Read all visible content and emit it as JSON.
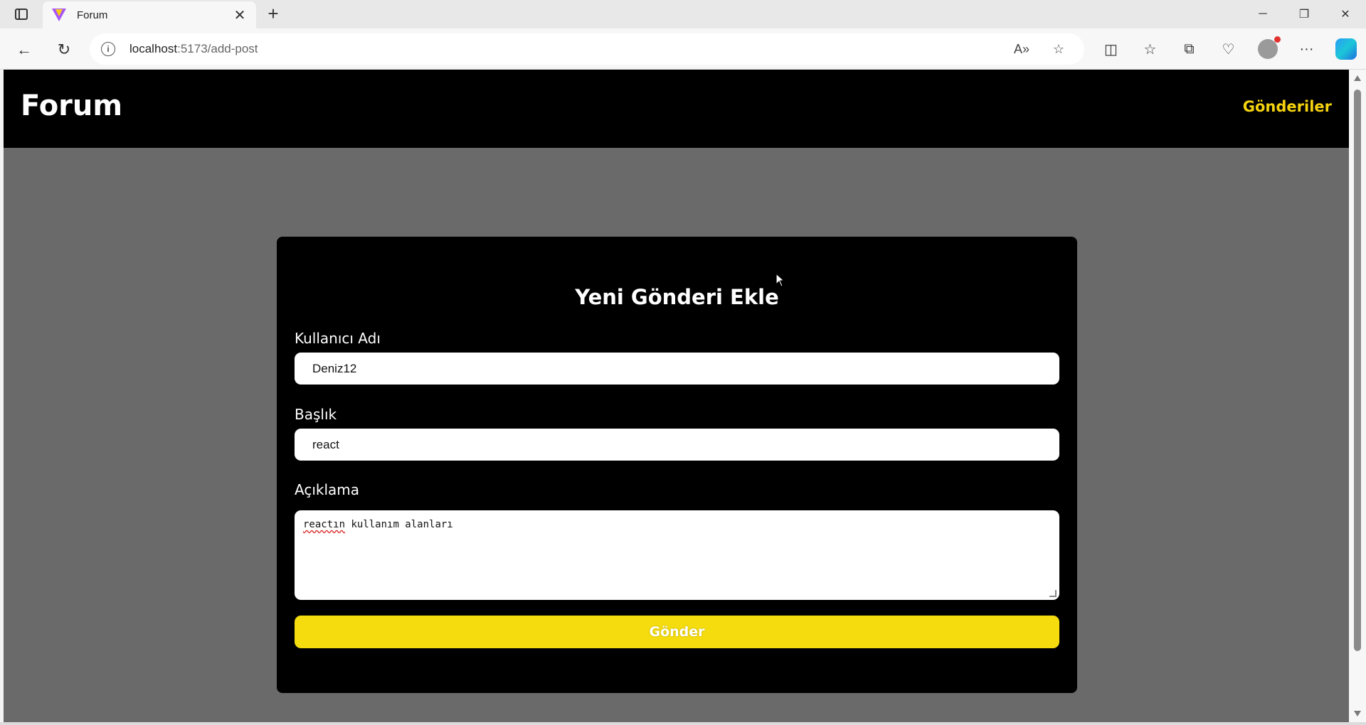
{
  "browser": {
    "tab_title": "Forum",
    "url_host": "localhost",
    "url_path": ":5173/add-post"
  },
  "site": {
    "logo": "Forum",
    "nav_link": "Gönderiler"
  },
  "form": {
    "title": "Yeni Gönderi Ekle",
    "username_label": "Kullanıcı Adı",
    "username_value": "Deniz12",
    "title_label": "Başlık",
    "title_value": "react",
    "description_label": "Açıklama",
    "description_word1": "reactın",
    "description_rest": " kullanım alanları",
    "submit_label": "Gönder"
  },
  "colors": {
    "header_bg": "#000000",
    "accent_yellow": "#f4dc0e",
    "page_bg": "#6a6a6a"
  }
}
